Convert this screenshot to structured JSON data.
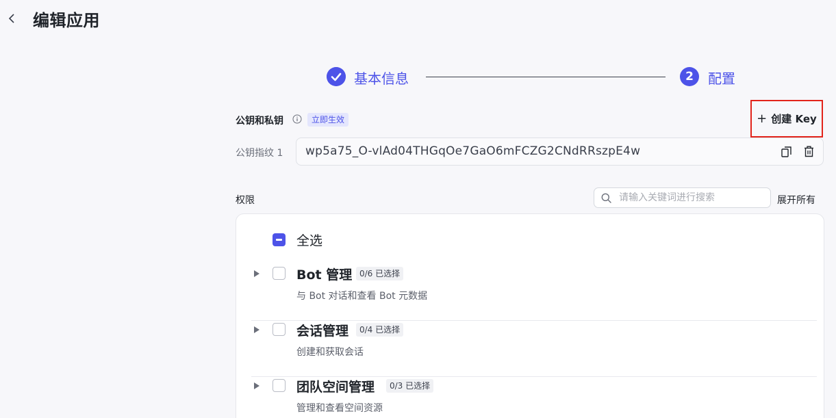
{
  "header": {
    "title": "编辑应用"
  },
  "steps": [
    {
      "label": "基本信息",
      "status": "done"
    },
    {
      "number": "2",
      "label": "配置",
      "status": "current"
    }
  ],
  "keys": {
    "label": "公钥和私钥",
    "tag": "立即生效",
    "create_button": "创建 Key",
    "fingerprint_label": "公钥指纹 1",
    "fingerprint_value": "wp5a75_O-vlAd04THGqOe7GaO6mFCZG2CNdRRszpE4w"
  },
  "permissions": {
    "label": "权限",
    "search_placeholder": "请输入关键词进行搜索",
    "expand_all": "展开所有",
    "select_all": "全选",
    "groups": [
      {
        "title": "Bot 管理",
        "count": "0/6 已选择",
        "desc": "与 Bot 对话和查看 Bot 元数据"
      },
      {
        "title": "会话管理",
        "count": "0/4 已选择",
        "desc": "创建和获取会话"
      },
      {
        "title": "团队空间管理",
        "count": "0/3 已选择",
        "desc": "管理和查看空间资源"
      }
    ]
  },
  "colors": {
    "accent": "#4d53e8",
    "highlight_border": "#e2231a"
  }
}
